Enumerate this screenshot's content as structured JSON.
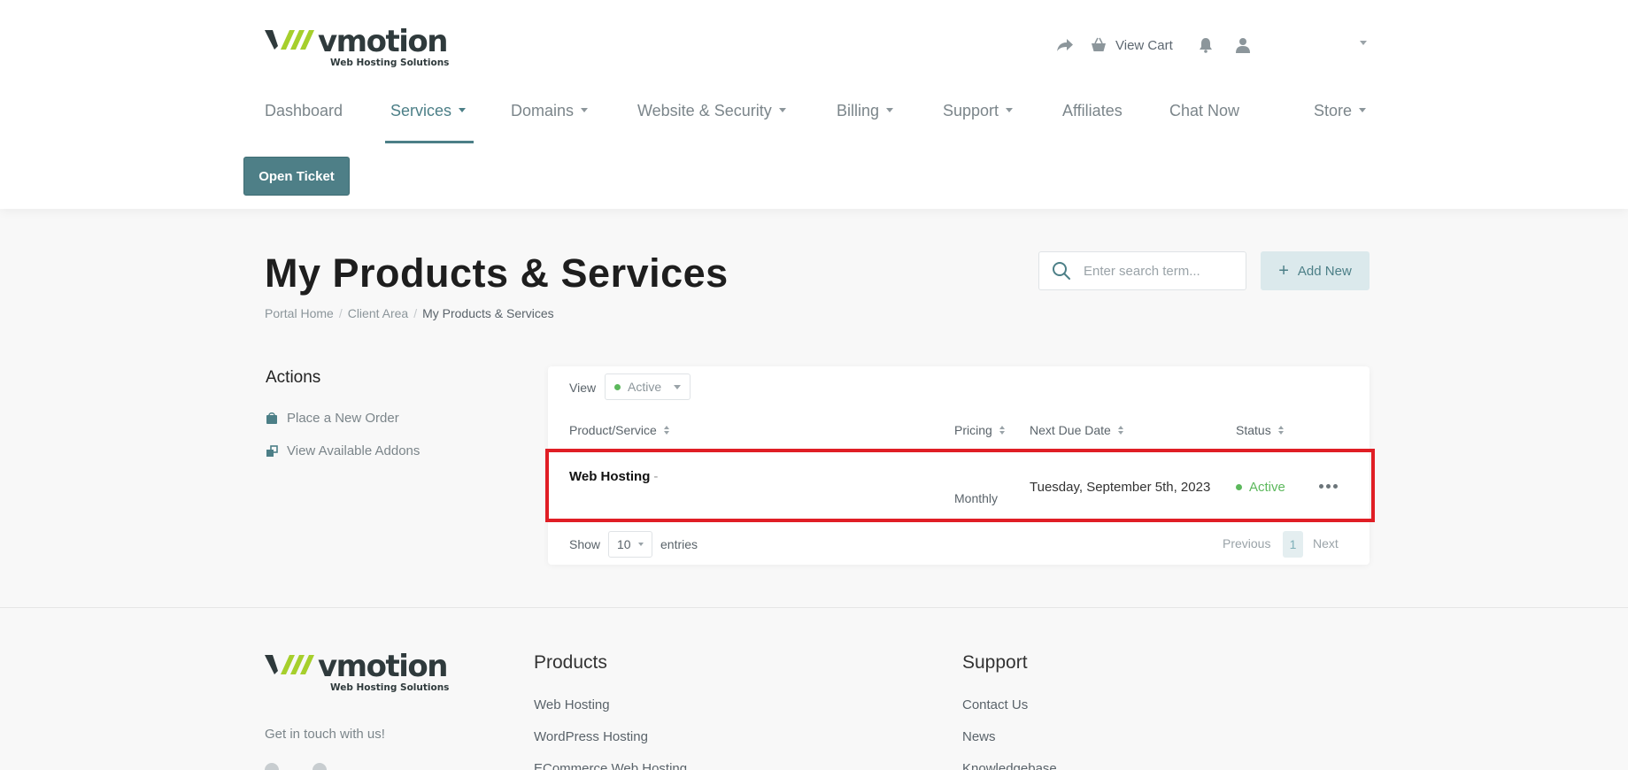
{
  "brand": {
    "name": "vmotion",
    "tagline": "Web Hosting Solutions",
    "colors": {
      "teal": "#4e7f87",
      "lime": "#a6cf2c",
      "dark": "#2f3a3c",
      "active_green": "#5cb85c",
      "highlight_red": "#e01e25"
    }
  },
  "top_util": {
    "share_icon": "share-arrow-icon",
    "cart_icon": "basket-icon",
    "cart_label": "View Cart",
    "bell_icon": "bell-icon",
    "user_icon": "user-icon"
  },
  "nav": {
    "items": [
      {
        "label": "Dashboard",
        "dropdown": false
      },
      {
        "label": "Services",
        "dropdown": true,
        "active": true
      },
      {
        "label": "Domains",
        "dropdown": true
      },
      {
        "label": "Website & Security",
        "dropdown": true
      },
      {
        "label": "Billing",
        "dropdown": true
      },
      {
        "label": "Support",
        "dropdown": true
      },
      {
        "label": "Affiliates",
        "dropdown": false
      },
      {
        "label": "Chat Now",
        "dropdown": false
      },
      {
        "label": "Store",
        "dropdown": true
      }
    ]
  },
  "open_ticket_label": "Open Ticket",
  "page": {
    "title": "My Products & Services",
    "breadcrumb": [
      "Portal Home",
      "Client Area",
      "My Products & Services"
    ],
    "search_placeholder": "Enter search term...",
    "add_new_label": "Add New"
  },
  "sidebar": {
    "title": "Actions",
    "links": [
      {
        "label": "Place a New Order",
        "icon": "shopping-bag-icon"
      },
      {
        "label": "View Available Addons",
        "icon": "addons-icon"
      }
    ]
  },
  "table": {
    "view_label": "View",
    "view_value": "Active",
    "columns": [
      "Product/Service",
      "Pricing",
      "Next Due Date",
      "Status"
    ],
    "rows": [
      {
        "product": "Web Hosting",
        "suffix": "-",
        "pricing": "Monthly",
        "next_due": "Tuesday, September 5th, 2023",
        "status": "Active"
      }
    ],
    "show_label": "Show",
    "entries_value": "10",
    "entries_label": "entries",
    "pager": {
      "previous": "Previous",
      "page": "1",
      "next": "Next"
    }
  },
  "footer": {
    "tagline": "Get in touch with us!",
    "products_heading": "Products",
    "products_links": [
      "Web Hosting",
      "WordPress Hosting",
      "ECommerce Web Hosting"
    ],
    "support_heading": "Support",
    "support_links": [
      "Contact Us",
      "News",
      "Knowledgebase"
    ]
  }
}
